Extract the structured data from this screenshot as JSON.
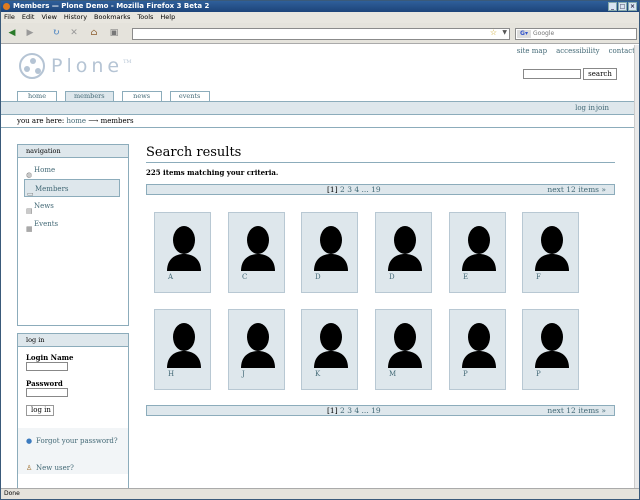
{
  "window": {
    "title": "Members — Plone Demo - Mozilla Firefox 3 Beta 2",
    "status": "Done"
  },
  "menu": [
    "File",
    "Edit",
    "View",
    "History",
    "Bookmarks",
    "Tools",
    "Help"
  ],
  "search_engine": {
    "placeholder": "Google"
  },
  "site": {
    "logo_text": "Plone",
    "actions": [
      "site map",
      "accessibility",
      "contact"
    ],
    "search_button": "search",
    "tabs": [
      {
        "label": "home",
        "selected": false
      },
      {
        "label": "members",
        "selected": true
      },
      {
        "label": "news",
        "selected": false
      },
      {
        "label": "events",
        "selected": false
      }
    ],
    "personal": {
      "login": "log in",
      "join": "join"
    },
    "breadcrumb": {
      "prefix": "you are here:",
      "home": "home",
      "separator": "⟶",
      "current": "members"
    }
  },
  "navigation": {
    "title": "navigation",
    "items": [
      {
        "label": "Home",
        "icon": "home-icon",
        "selected": false
      },
      {
        "label": "Members",
        "icon": "folder-icon",
        "selected": true
      },
      {
        "label": "News",
        "icon": "news-icon",
        "selected": false
      },
      {
        "label": "Events",
        "icon": "event-icon",
        "selected": false
      }
    ]
  },
  "login": {
    "title": "log in",
    "login_name_label": "Login Name",
    "password_label": "Password",
    "button": "log in",
    "forgot": "Forgot your password?",
    "new_user": "New user?"
  },
  "results": {
    "heading": "Search results",
    "count_text": "225 items matching your criteria.",
    "pager": {
      "current": "[1]",
      "pages": [
        "2",
        "3",
        "4"
      ],
      "ellipsis": "...",
      "last": "19",
      "next": "next 12 items »"
    },
    "members": [
      {
        "name": "A"
      },
      {
        "name": "C"
      },
      {
        "name": "D"
      },
      {
        "name": "D"
      },
      {
        "name": "E"
      },
      {
        "name": "F"
      },
      {
        "name": "H"
      },
      {
        "name": "J"
      },
      {
        "name": "K"
      },
      {
        "name": "M"
      },
      {
        "name": "P"
      },
      {
        "name": "P"
      }
    ]
  }
}
